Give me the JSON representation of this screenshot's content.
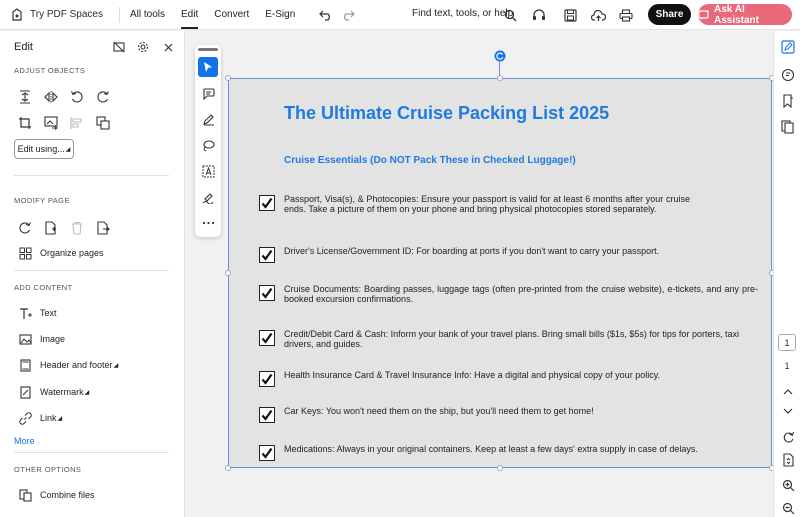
{
  "topbar": {
    "brand": "Try PDF Spaces",
    "menu": [
      "All tools",
      "Edit",
      "Convert",
      "E-Sign"
    ],
    "active_menu": "Edit",
    "find_placeholder": "Find text, tools, or help",
    "share_label": "Share",
    "ai_label": "Ask AI Assistant",
    "ai_color": "#e86a7a"
  },
  "leftpanel": {
    "title": "Edit",
    "adjust_objects": "ADJUST OBJECTS",
    "edit_using": "Edit using...",
    "modify_page": "MODIFY PAGE",
    "organize_pages": "Organize pages",
    "add_content": "ADD CONTENT",
    "add_items": [
      "Text",
      "Image",
      "Header and footer",
      "Watermark",
      "Link"
    ],
    "more": "More",
    "other_options": "OTHER OPTIONS",
    "combine_files": "Combine files"
  },
  "document": {
    "title": "The Ultimate Cruise Packing List 2025",
    "subtitle": "Cruise Essentials (Do NOT Pack These in Checked Luggage!)",
    "items": [
      "Passport, Visa(s), & Photocopies: Ensure your passport is valid for at least 6 months after your cruise ends. Take a picture of them on your phone and bring physical photocopies stored separately.",
      "Driver's License/Government ID: For boarding at ports if you don't want to carry your passport.",
      "Cruise Documents: Boarding passes, luggage tags (often pre-printed from the cruise website), e-tickets, and any pre-booked excursion confirmations.",
      "Credit/Debit Card & Cash: Inform your bank of your travel plans. Bring small bills ($1s, $5s) for tips for porters, taxi drivers, and guides.",
      "Health Insurance Card & Travel Insurance Info: Have a digital and physical copy of your policy.",
      "Car Keys: You won't need them on the ship, but you'll need them to get home!",
      "Medications: Always in your original containers. Keep at least a few days' extra supply in case of delays."
    ],
    "accent_color": "#1e7be0"
  },
  "pagination": {
    "current": "1",
    "total": "1"
  }
}
